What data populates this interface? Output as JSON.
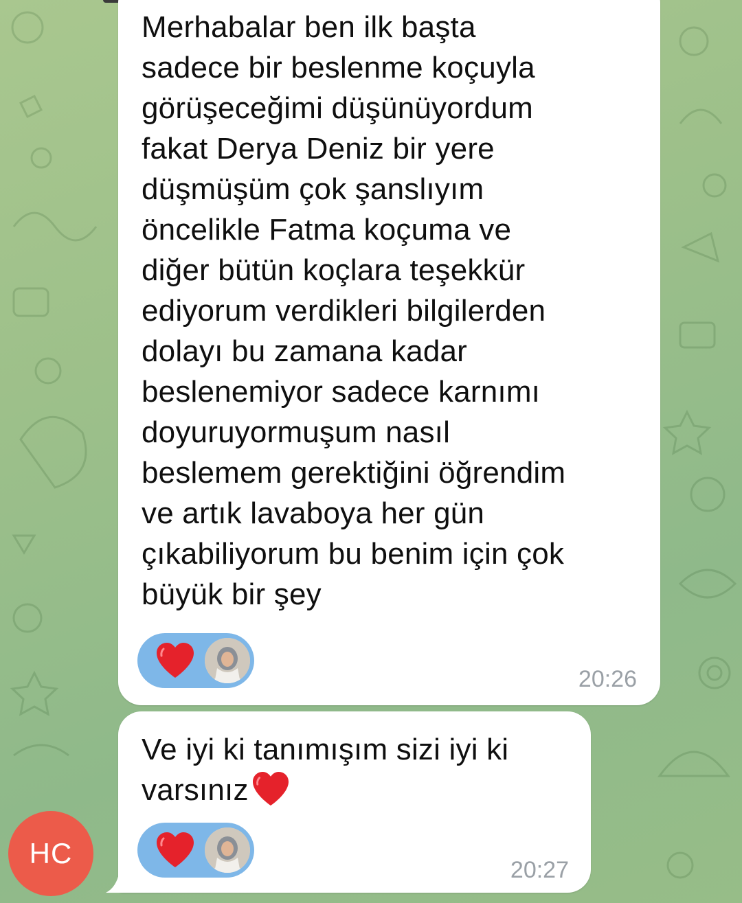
{
  "messages": [
    {
      "text": "Merhabalar ben ilk başta\nsadece bir beslenme koçuyla\ngörüşeceğimi düşünüyordum\nfakat Derya Deniz bir yere\ndüşmüşüm çok şanslıyım\nöncelikle Fatma koçuma ve\ndiğer bütün koçlara teşekkür\nediyorum verdikleri bilgilerden\ndolayı bu zamana kadar\nbeslenemiyor sadece karnımı\ndoyuruyormuşum nasıl\nbeslemem gerektiğini öğrendim\nve artık lavaboya her gün\nçıkabiliyorum bu benim için çok\nbüyük bir şey",
      "time": "20:26",
      "reaction": {
        "emoji": "heart-icon",
        "reactor": "avatar-thumbnail"
      }
    },
    {
      "text": "Ve iyi ki tanımışım sizi iyi ki\nvarsınız",
      "trailing_emoji": "heart-icon",
      "time": "20:27",
      "reaction": {
        "emoji": "heart-icon",
        "reactor": "avatar-thumbnail"
      }
    }
  ],
  "sender": {
    "initials": "HC",
    "avatar_color": "#ec5b4a"
  },
  "colors": {
    "bubble": "#ffffff",
    "reaction_pill": "#7eb7e8",
    "heart": "#e5222b",
    "timestamp": "#9aa0a6"
  }
}
